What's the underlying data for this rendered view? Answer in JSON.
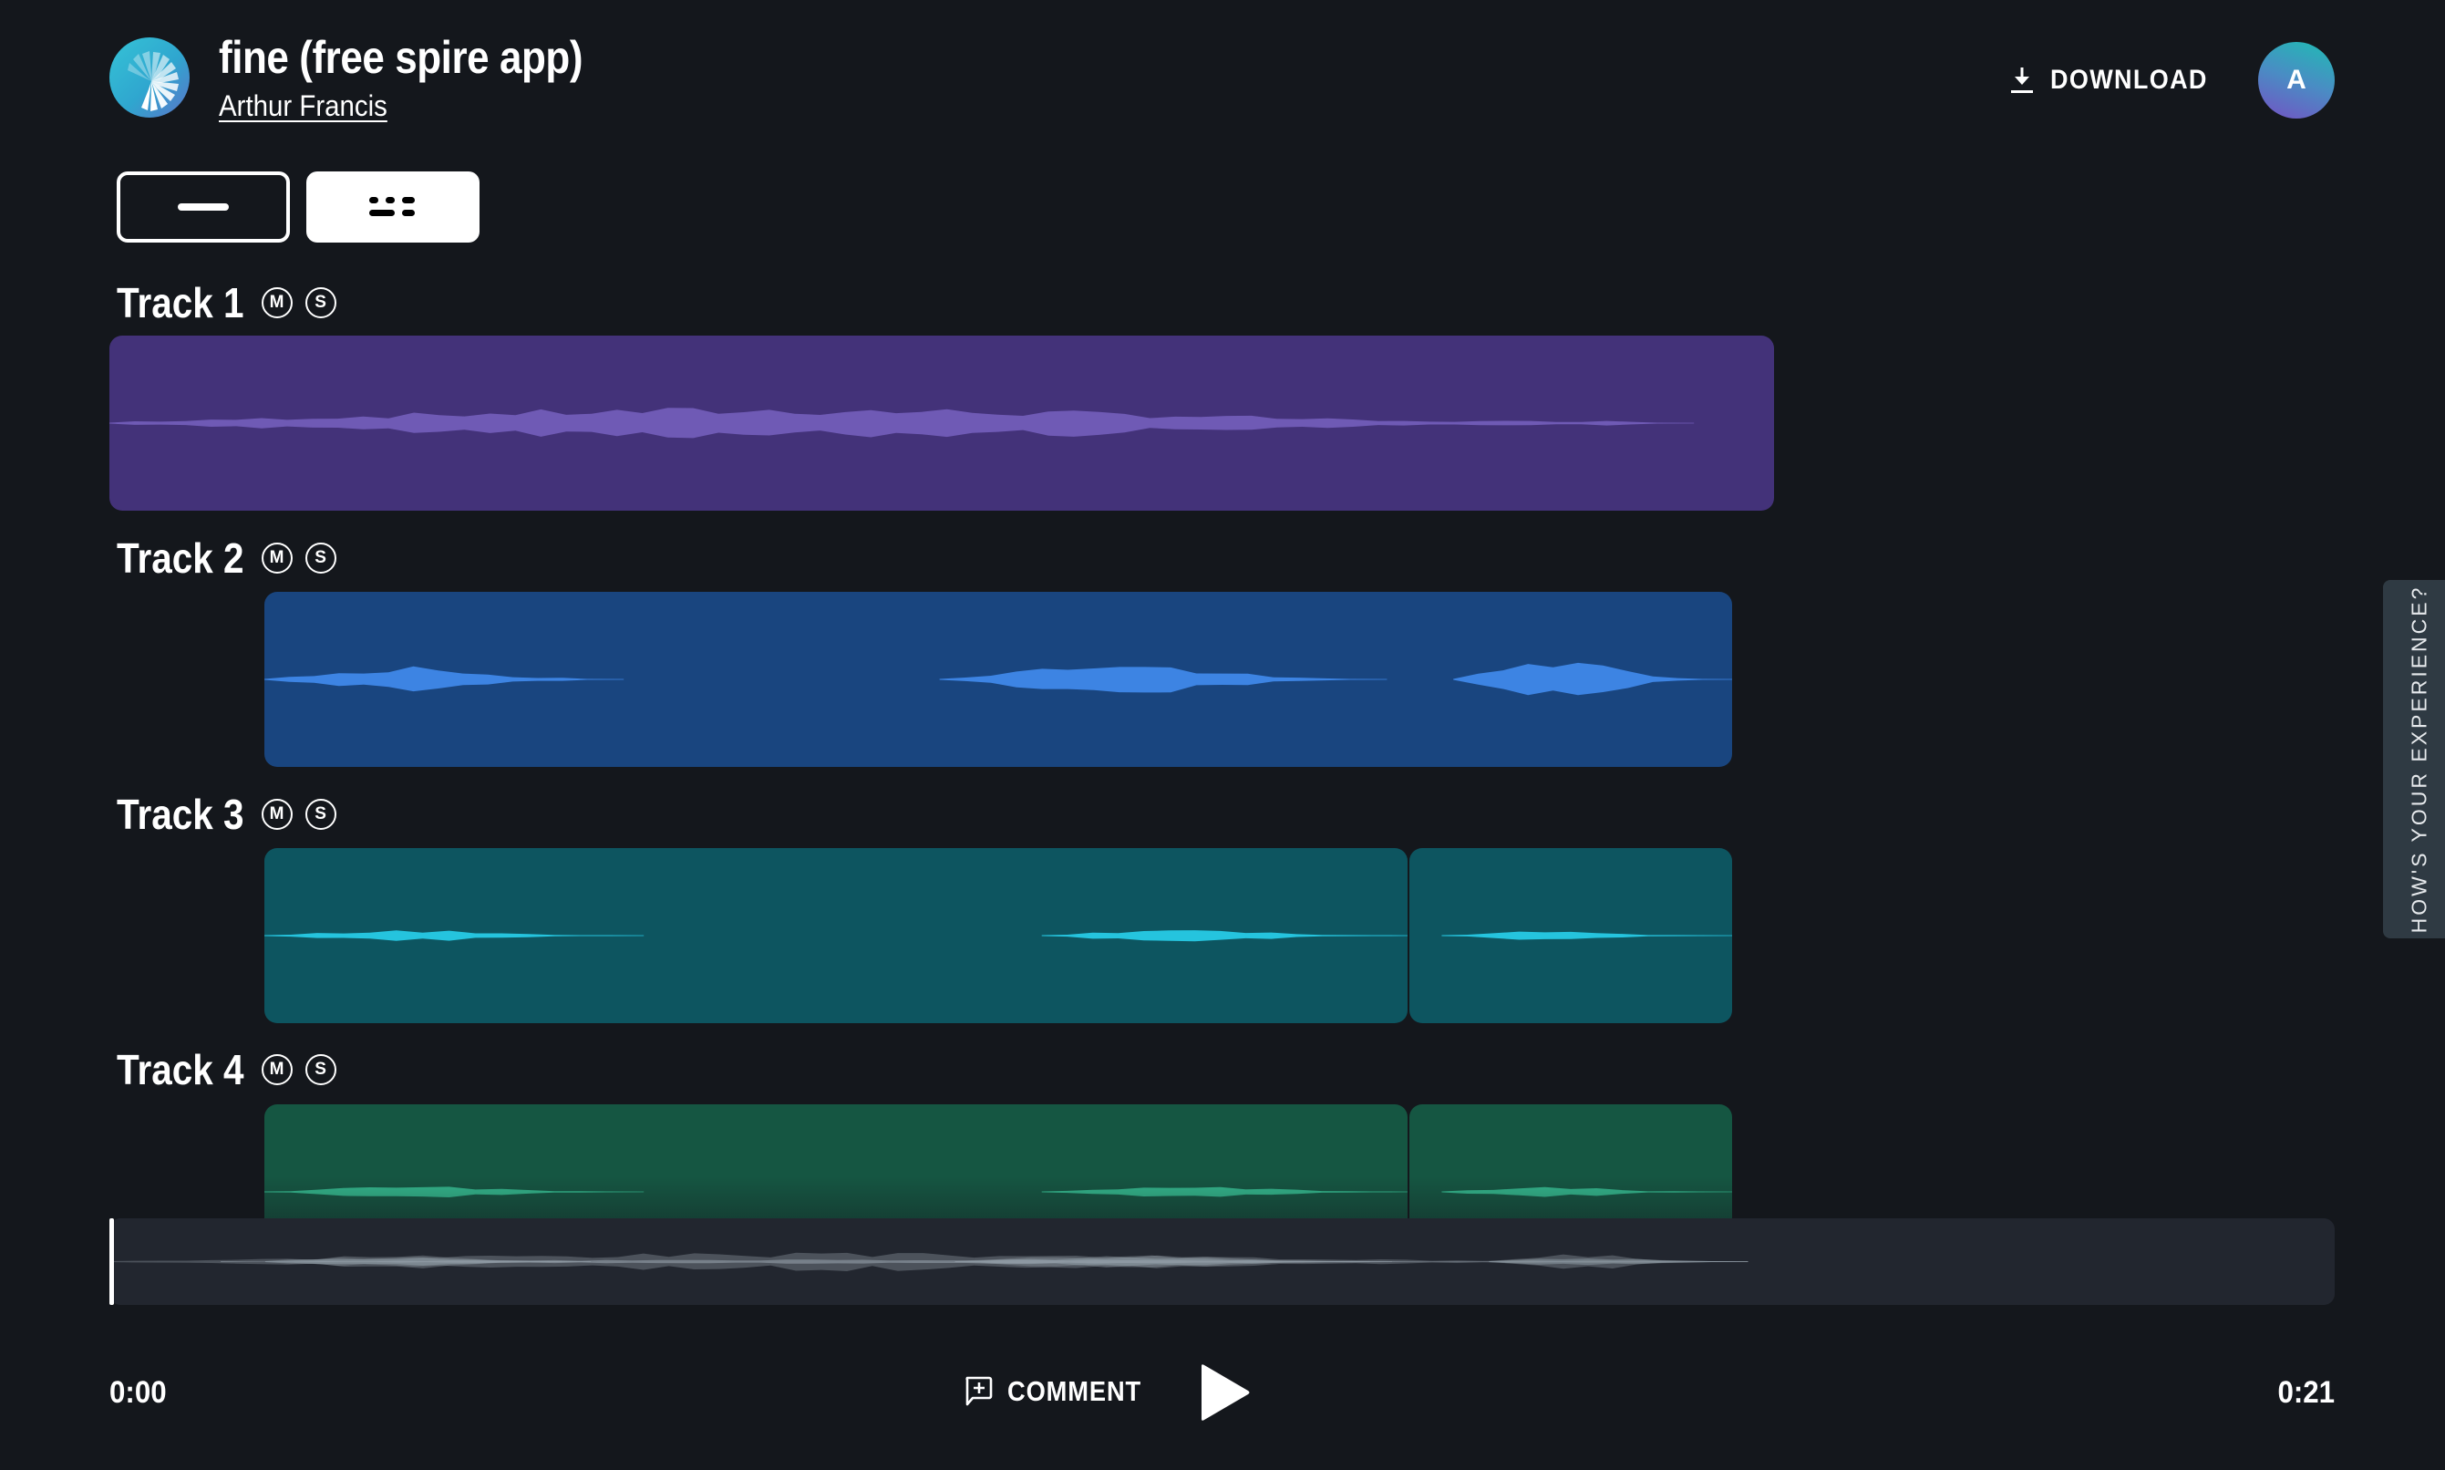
{
  "header": {
    "project_title": "fine (free spire app)",
    "author": "Arthur Francis",
    "download_label": "DOWNLOAD",
    "avatar_initial": "A",
    "logo_icon": "spire-fan-logo",
    "download_icon": "download-arrow-icon"
  },
  "view_toggle": {
    "options": [
      {
        "name": "single-lane-view",
        "icon": "single-line-icon",
        "selected": false
      },
      {
        "name": "multitrack-view",
        "icon": "multi-line-icon",
        "selected": true
      }
    ]
  },
  "tracks": [
    {
      "name": "Track 1",
      "mute_label": "M",
      "solo_label": "S",
      "clip_color": "#433279",
      "wave_color": "#6f5ab5"
    },
    {
      "name": "Track 2",
      "mute_label": "M",
      "solo_label": "S",
      "clip_color": "#19457f",
      "wave_color": "#3d84e3"
    },
    {
      "name": "Track 3",
      "mute_label": "M",
      "solo_label": "S",
      "clip_color": "#0d5560",
      "wave_color": "#25c4de"
    },
    {
      "name": "Track 4",
      "mute_label": "M",
      "solo_label": "S",
      "clip_color": "#155642",
      "wave_color": "#33b58b"
    }
  ],
  "transport": {
    "current_time": "0:00",
    "total_time": "0:21",
    "comment_label": "COMMENT",
    "comment_icon": "comment-plus-icon",
    "play_icon": "play-icon",
    "playhead_position": 0
  },
  "feedback": {
    "label": "HOW'S YOUR EXPERIENCE?"
  }
}
